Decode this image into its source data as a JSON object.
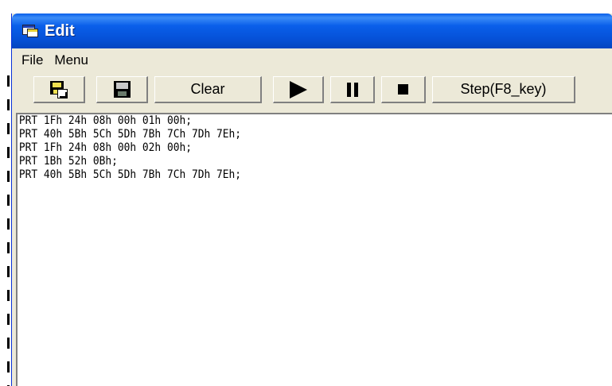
{
  "window": {
    "title": "Edit",
    "icon": "window-icon"
  },
  "menu": [
    "File",
    "Menu"
  ],
  "toolbar": {
    "open_icon": "open-file-icon",
    "save_icon": "save-disk-icon",
    "clear_label": "Clear",
    "play_icon": "play-icon",
    "pause_icon": "pause-icon",
    "stop_icon": "stop-icon",
    "step_label": "Step(F8_key)"
  },
  "editor": {
    "lines": [
      "PRT 1Fh 24h 08h 00h 01h 00h;",
      "PRT 40h 5Bh 5Ch 5Dh 7Bh 7Ch 7Dh 7Eh;",
      "PRT 1Fh 24h 08h 00h 02h 00h;",
      "PRT 1Bh 52h 0Bh;",
      "PRT 40h 5Bh 5Ch 5Dh 7Bh 7Ch 7Dh 7Eh;"
    ]
  }
}
